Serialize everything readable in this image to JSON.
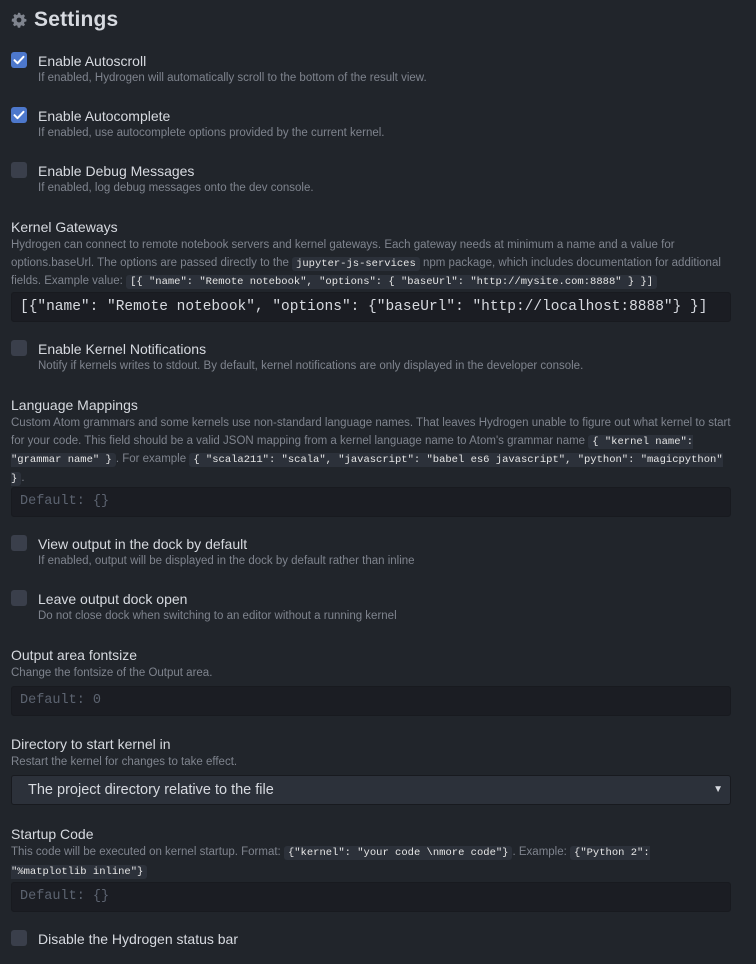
{
  "header": {
    "title": "Settings",
    "icon": "gear-icon"
  },
  "settings": {
    "autoscroll": {
      "label": "Enable Autoscroll",
      "desc": "If enabled, Hydrogen will automatically scroll to the bottom of the result view.",
      "checked": true
    },
    "autocomplete": {
      "label": "Enable Autocomplete",
      "desc": "If enabled, use autocomplete options provided by the current kernel.",
      "checked": true
    },
    "debug": {
      "label": "Enable Debug Messages",
      "desc": "If enabled, log debug messages onto the dev console.",
      "checked": false
    },
    "gateways": {
      "label": "Kernel Gateways",
      "desc_1": "Hydrogen can connect to remote notebook servers and kernel gateways. Each gateway needs at minimum a name and a value for options.baseUrl. The options are passed directly to the ",
      "code_1": "jupyter-js-services",
      "desc_2": " npm package, which includes documentation for additional fields. Example value: ",
      "code_2": "[{ \"name\": \"Remote notebook\", \"options\": { \"baseUrl\": \"http://mysite.com:8888\" } }]",
      "value": "[{\"name\": \"Remote notebook\", \"options\": {\"baseUrl\": \"http://localhost:8888\"} }]"
    },
    "notifications": {
      "label": "Enable Kernel Notifications",
      "desc": "Notify if kernels writes to stdout. By default, kernel notifications are only displayed in the developer console.",
      "checked": false
    },
    "mappings": {
      "label": "Language Mappings",
      "desc_1": "Custom Atom grammars and some kernels use non-standard language names. That leaves Hydrogen unable to figure out what kernel to start for your code. This field should be a valid JSON mapping from a kernel language name to Atom's grammar name ",
      "code_1": "{ \"kernel name\": \"grammar name\" }",
      "desc_2": ". For example ",
      "code_2": "{ \"scala211\": \"scala\", \"javascript\": \"babel es6 javascript\", \"python\": \"magicpython\" }",
      "desc_3": ".",
      "placeholder": "Default: {}"
    },
    "dock_default": {
      "label": "View output in the dock by default",
      "desc": "If enabled, output will be displayed in the dock by default rather than inline",
      "checked": false
    },
    "dock_open": {
      "label": "Leave output dock open",
      "desc": "Do not close dock when switching to an editor without a running kernel",
      "checked": false
    },
    "fontsize": {
      "label": "Output area fontsize",
      "desc": "Change the fontsize of the Output area.",
      "placeholder": "Default: 0"
    },
    "directory": {
      "label": "Directory to start kernel in",
      "desc": "Restart the kernel for changes to take effect.",
      "selected": "The project directory relative to the file"
    },
    "startup": {
      "label": "Startup Code",
      "desc_1": "This code will be executed on kernel startup. Format: ",
      "code_1": "{\"kernel\": \"your code \\nmore code\"}",
      "desc_2": ". Example: ",
      "code_2": "{\"Python 2\": \"%matplotlib inline\"}",
      "placeholder": "Default: {}"
    },
    "statusbar": {
      "label": "Disable the Hydrogen status bar",
      "checked": false
    }
  },
  "colors": {
    "background": "#21252b",
    "checkbox_checked": "#4d78cc",
    "checkbox_unchecked": "#3a3f4b"
  }
}
